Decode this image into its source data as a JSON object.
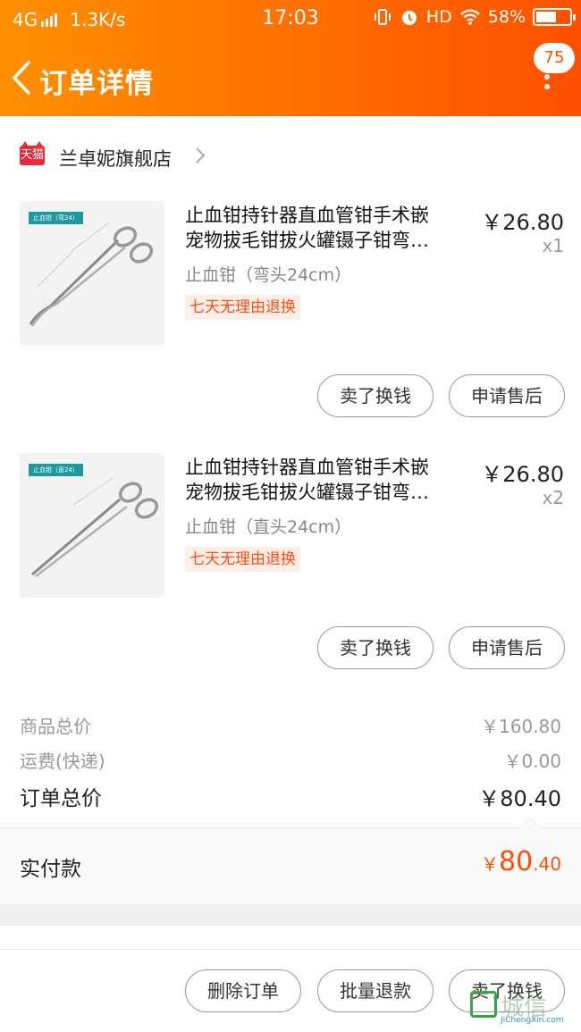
{
  "status_bar": {
    "network": "4G",
    "speed": "1.3K/s",
    "time": "17:03",
    "hd": "HD",
    "battery": "58%"
  },
  "header": {
    "title": "订单详情",
    "badge_count": "75",
    "color_start": "#ff9000",
    "color_end": "#ff5000"
  },
  "shop": {
    "logo_text": "天猫",
    "name": "兰卓妮旗舰店"
  },
  "items": [
    {
      "title_line1": "止血钳持针器直血管钳手术嵌",
      "title_line2": "宠物拔毛钳拔火罐镊子钳弯…",
      "spec": "止血钳（弯头24cm）",
      "tag": "七天无理由退换",
      "price": "￥26.80",
      "qty": "x1",
      "thumb_tag": "止血钳（弯24）",
      "btn_sell": "卖了换钱",
      "btn_after": "申请售后"
    },
    {
      "title_line1": "止血钳持针器直血管钳手术嵌",
      "title_line2": "宠物拔毛钳拔火罐镊子钳弯…",
      "spec": "止血钳（直头24cm）",
      "tag": "七天无理由退换",
      "price": "￥26.80",
      "qty": "x2",
      "thumb_tag": "止血钳（直24）",
      "btn_sell": "卖了换钱",
      "btn_after": "申请售后"
    }
  ],
  "summary": {
    "goods_total_label": "商品总价",
    "goods_total_value": "￥160.80",
    "shipping_label": "运费(快递)",
    "shipping_value": "￥0.00",
    "order_total_label": "订单总价",
    "order_total_value": "￥80.40"
  },
  "paid": {
    "label": "实付款",
    "currency": "￥",
    "integer": "80",
    "decimal": ".40",
    "color": "#ff5000"
  },
  "bottom_actions": {
    "delete": "删除订单",
    "batch_refund": "批量退款",
    "sell": "卖了换钱"
  },
  "watermark": {
    "text": "城信",
    "sub": "JiChengXin.com"
  }
}
